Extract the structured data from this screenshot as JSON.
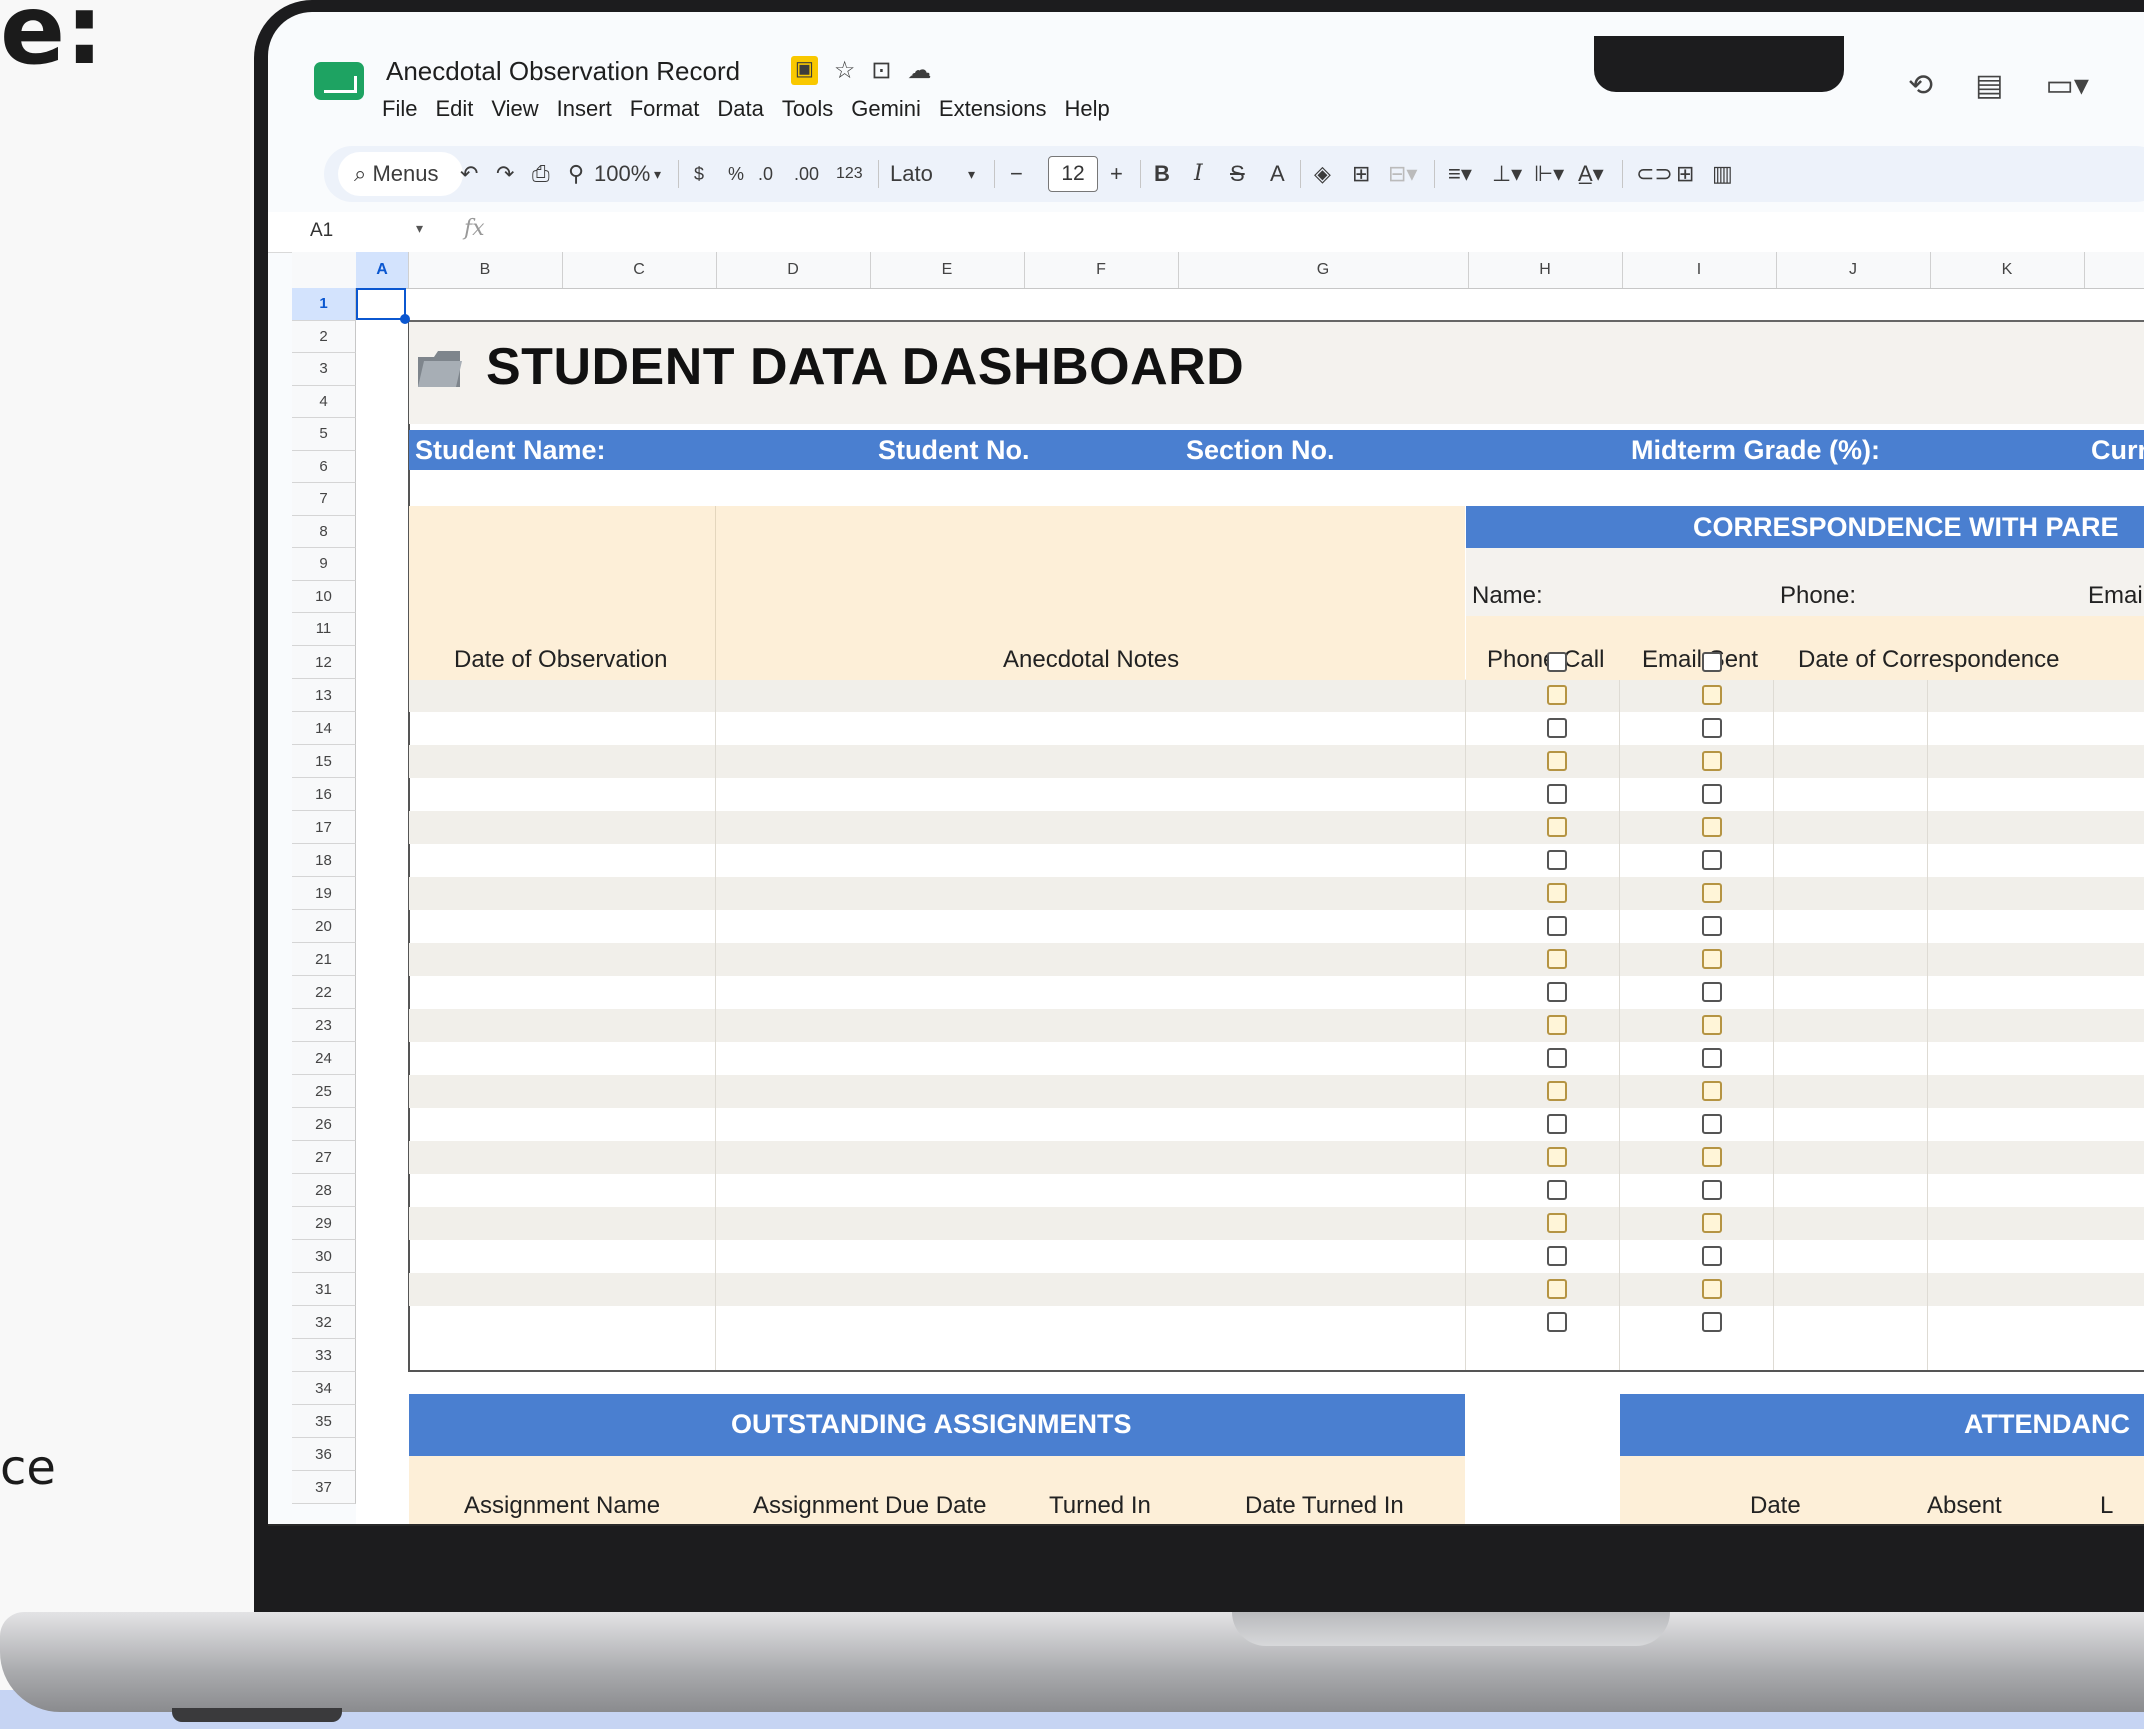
{
  "background": {
    "fragment_top": "e:",
    "fragment_side": "ce"
  },
  "app": {
    "title": "Anecdotal Observation Record",
    "menu": [
      "File",
      "Edit",
      "View",
      "Insert",
      "Format",
      "Data",
      "Tools",
      "Gemini",
      "Extensions",
      "Help"
    ]
  },
  "toolbar": {
    "search_label": "Menus",
    "zoom": "100%",
    "currency": "$",
    "percent": "%",
    "decimal_decrease": ".0",
    "decimal_increase": ".00",
    "number_format": "123",
    "font": "Lato",
    "font_size": "12",
    "minus": "−",
    "plus": "+",
    "bold": "B",
    "italic": "I",
    "strike": "S",
    "text_color": "A"
  },
  "formula_bar": {
    "cell_ref": "A1",
    "fx": "fx"
  },
  "columns": [
    "A",
    "B",
    "C",
    "D",
    "E",
    "F",
    "G",
    "H",
    "I",
    "J",
    "K"
  ],
  "rows": [
    "1",
    "2",
    "3",
    "4",
    "5",
    "6",
    "7",
    "8",
    "9",
    "10",
    "11",
    "12",
    "13",
    "14",
    "15",
    "16",
    "17",
    "18",
    "19",
    "20",
    "21",
    "22",
    "23",
    "24",
    "25",
    "26",
    "27",
    "28",
    "29",
    "30",
    "31",
    "32",
    "33",
    "34",
    "35",
    "36",
    "37"
  ],
  "dashboard": {
    "title": "STUDENT DATA DASHBOARD",
    "student_row": {
      "name": "Student Name:",
      "number": "Student No.",
      "section": "Section No.",
      "midterm": "Midterm Grade (%):",
      "current": "Curr"
    },
    "observation": {
      "date_header": "Date of Observation",
      "notes_header": "Anecdotal Notes"
    },
    "correspondence": {
      "title": "CORRESPONDENCE WITH PARE",
      "name_label": "Name:",
      "phone_label": "Phone:",
      "email_label": "Emai",
      "phone_call": "Phone Call",
      "email_sent": "Email Sent",
      "date_header": "Date of Correspondence"
    },
    "assignments": {
      "title": "OUTSTANDING ASSIGNMENTS",
      "name": "Assignment Name",
      "due": "Assignment Due Date",
      "turned_in": "Turned In",
      "date_turned_in": "Date Turned In"
    },
    "attendance": {
      "title": "ATTENDANC",
      "date": "Date",
      "absent": "Absent",
      "late": "L"
    }
  },
  "colors": {
    "header_blue": "#4a7fd0",
    "cream": "#fdefd8",
    "selection": "#0b57d0"
  }
}
